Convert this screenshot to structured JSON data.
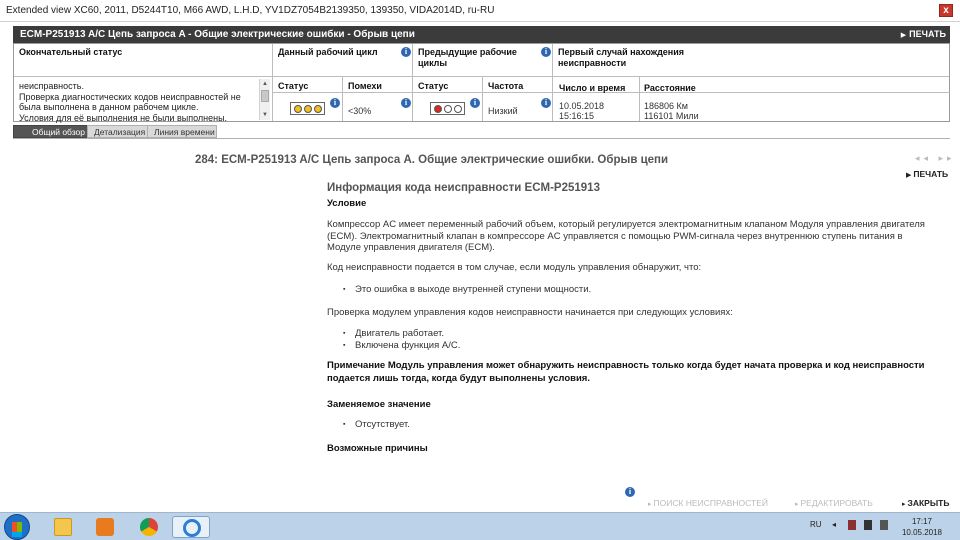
{
  "window": {
    "title": "Extended view   XC60, 2011, D5244T10, M66 AWD, L.H.D, YV1DZ7054B2139350, 139350, VIDA2014D, ru-RU",
    "close_label": "x"
  },
  "header": {
    "code": "ECM-P251913 A/C Цепь запроса A - Общие электрические ошибки - Обрыв цепи",
    "print_label": "ПЕЧАТЬ"
  },
  "grid": {
    "final_status_header": "Окончательный статус",
    "final_status_text": "неисправность.\nПроверка диагностических кодов неисправностей не была выполнена в данном рабочем цикле.\nУсловия для её выполнения не были выполнены.",
    "current_cycle_header": "Данный рабочий цикл",
    "status_label": "Статус",
    "interference_label": "Помехи",
    "interference_value": "<30%",
    "prev_cycles_header": "Предыдущие рабочие циклы",
    "prev_status_label": "Статус",
    "frequency_label": "Частота",
    "frequency_value": "Низкий",
    "first_case_header": "Первый случай нахождения неисправности",
    "datetime_label": "Число и время",
    "date_value": "10.05.2018",
    "time_value": "15:16:15",
    "distance_label": "Расстояние",
    "km_value": "186806 Км",
    "miles_value": "116101 Мили"
  },
  "tabs": [
    {
      "label": "Общий обзор",
      "active": true
    },
    {
      "label": "Детализация",
      "active": false
    },
    {
      "label": "Линия времени",
      "active": false
    }
  ],
  "doc": {
    "title": "284: ECM-P251913 A/C Цепь запроса A. Общие электрические ошибки. Обрыв цепи",
    "nav_arrows": "◂◂ ▸▸",
    "print_label": "ПЕЧАТЬ",
    "heading": "Информация кода неисправности ECM-P251913",
    "condition_heading": "Условие",
    "paragraph1": "Компрессор AC имеет переменный рабочий объем, который регулируется электромагнитным клапаном Модуля управления двигателя (ECM). Электромагнитный клапан в компрессоре AC управляется с помощью PWM-сигнала через внутреннюю ступень питания в Модуле управления двигателя (ECM).",
    "paragraph2": "Код неисправности подается в том случае, если модуль управления обнаружит, что:",
    "bullet1": "Это ошибка в выходе внутренней ступени мощности.",
    "paragraph3": "Проверка модулем управления кодов неисправности начинается при следующих условиях:",
    "bullet2": "Двигатель работает.",
    "bullet3": "Включена функция A/C.",
    "note": "Примечание Модуль управления может обнаружить неисправность только когда будет начата проверка и код неисправности подается лишь тогда, когда будут выполнены условия.",
    "replace_heading": "Заменяемое значение",
    "bullet4": "Отсутствует.",
    "causes_heading": "Возможные причины"
  },
  "actions": {
    "troubleshoot": "ПОИСК НЕИСПРАВНОСТЕЙ",
    "edit": "РЕДАКТИРОВАТЬ",
    "close": "ЗАКРЫТЬ"
  },
  "taskbar": {
    "lang": "RU",
    "time": "17:17",
    "date": "10.05.2018"
  },
  "colors": {
    "header_bg": "#3b3b3b",
    "info_blue": "#2f67b1",
    "taskbar": "#bcd2e8"
  }
}
